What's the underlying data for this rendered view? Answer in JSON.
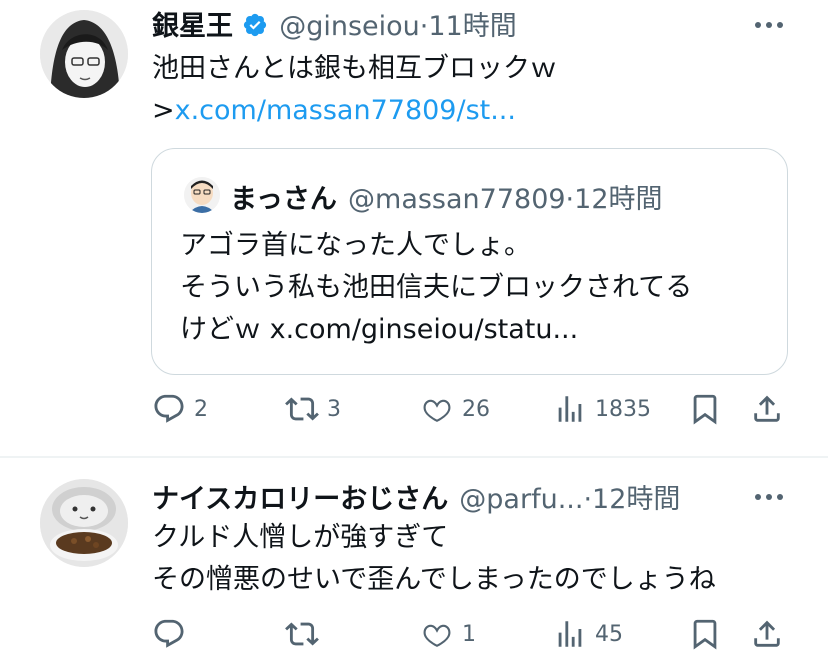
{
  "tweets": [
    {
      "name": "銀星王",
      "handle": "@ginseiou",
      "separator": "·",
      "time": "11時間",
      "verified": true,
      "text_line1": "池田さんとは銀も相互ブロックｗ",
      "text_line2_prefix": ">",
      "text_line2_link": "x.com/massan77809/st...",
      "quote": {
        "name": "まっさん",
        "handle": "@massan77809",
        "separator": "·",
        "time": "12時間",
        "line1": "アゴラ首になった人でしょ。",
        "line2": "そういう私も池田信夫にブロックされてる",
        "line3_prefix": "けどｗ",
        "line3_link": "x.com/ginseiou/statu..."
      },
      "actions": {
        "replies": "2",
        "reposts": "3",
        "likes": "26",
        "views": "1835"
      }
    },
    {
      "name": "ナイスカロリーおじさん",
      "handle": "@parfu...",
      "separator": "·",
      "time": "12時間",
      "text_line1": "クルド人憎しが強すぎて",
      "text_line2": "その憎悪のせいで歪んでしまったのでしょうね",
      "actions": {
        "replies": "",
        "reposts": "",
        "likes": "1",
        "views": "45"
      }
    }
  ],
  "colors": {
    "verified": "#1d9bf0",
    "link": "#1d9bf0",
    "muted": "#536471"
  },
  "icons": [
    "verified-badge-icon",
    "more-icon",
    "reply-icon",
    "repost-icon",
    "like-icon",
    "views-icon",
    "bookmark-icon",
    "share-icon"
  ]
}
